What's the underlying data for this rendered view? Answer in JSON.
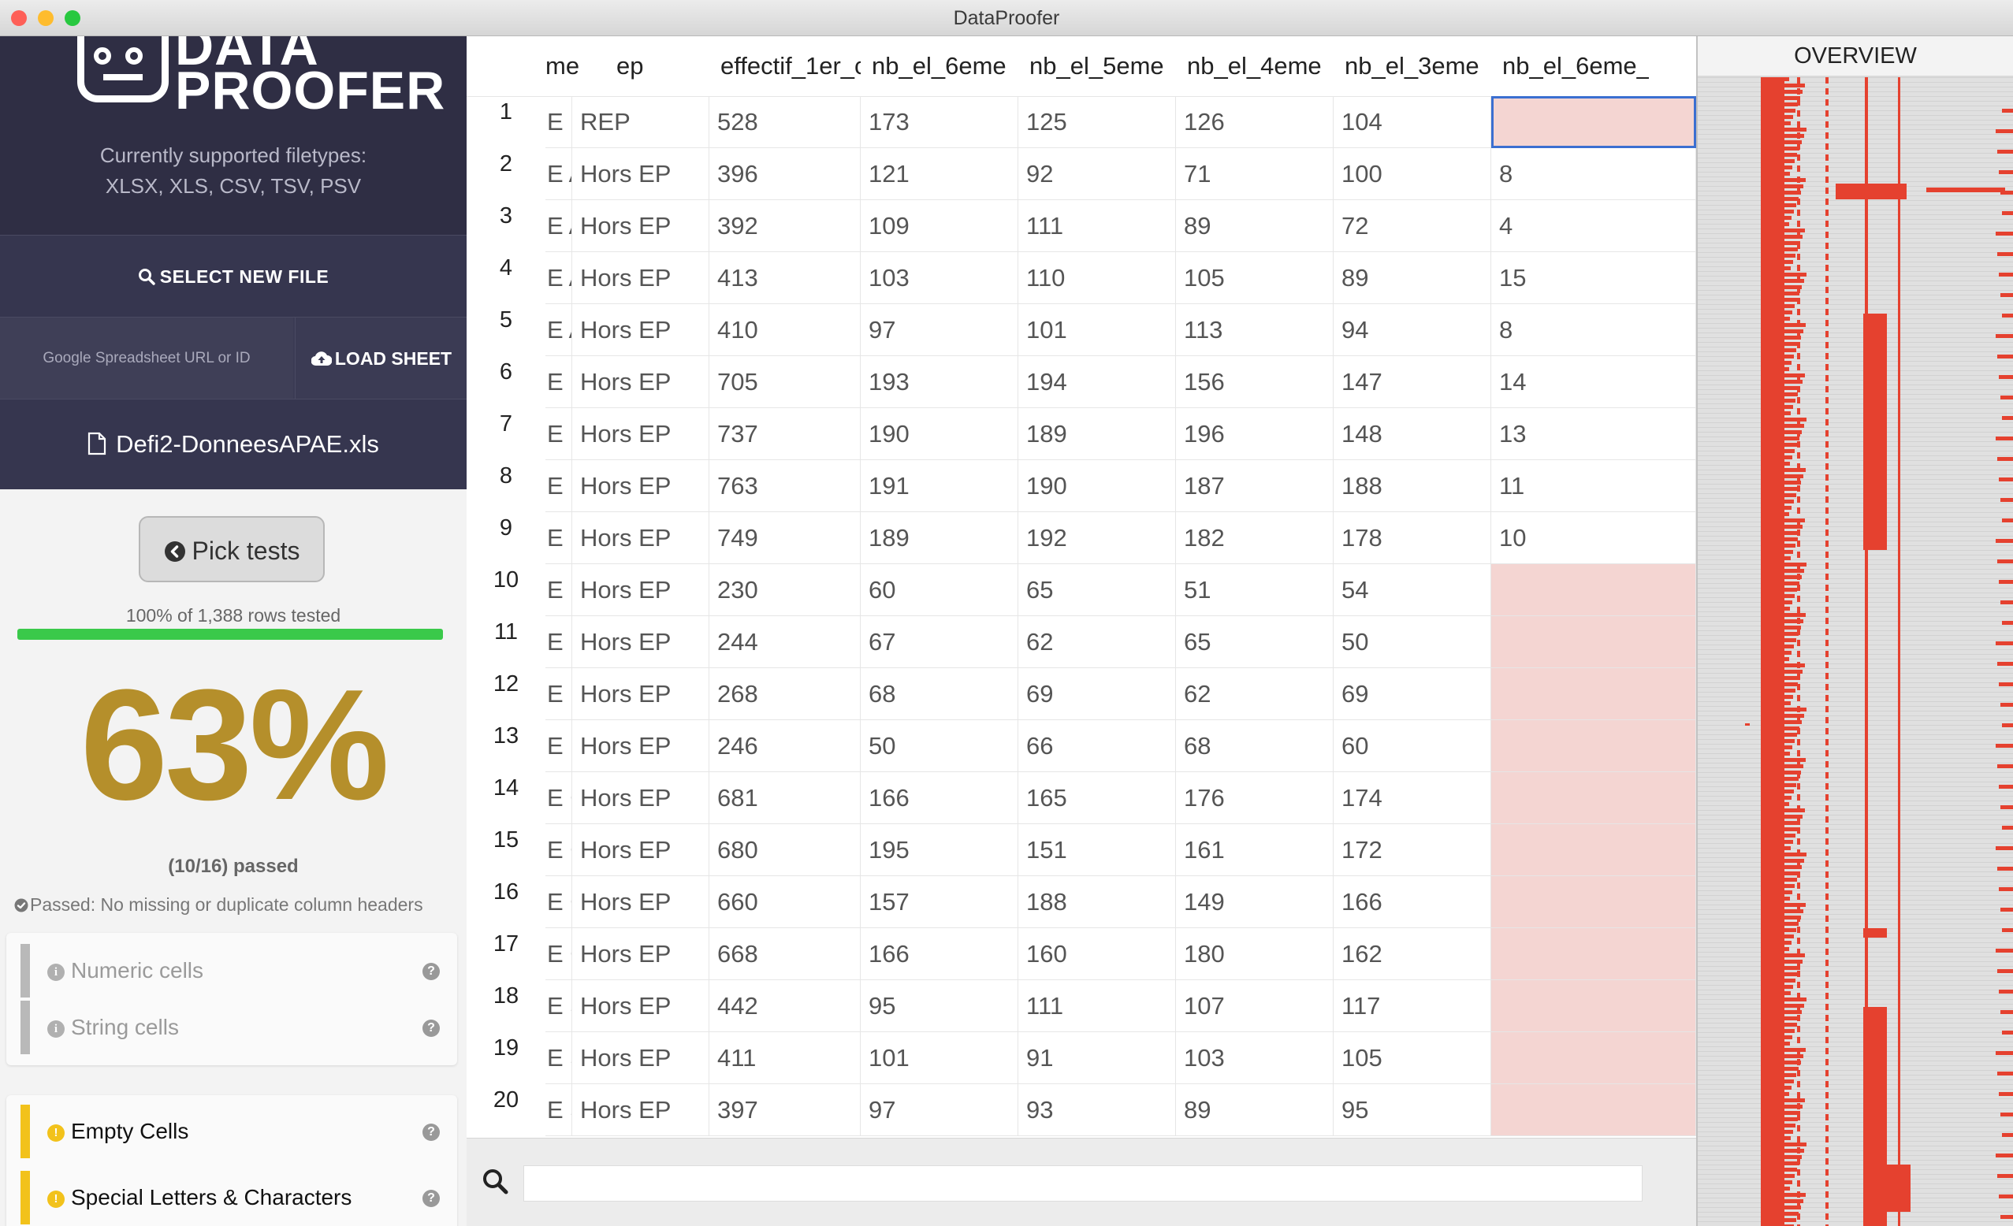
{
  "window": {
    "title": "DataProofer",
    "traffic_lights": {
      "close": "#fe5f57",
      "minimize": "#febc2e",
      "zoom": "#28c840"
    }
  },
  "sidebar": {
    "logo_text_top": "DATA",
    "logo_text_bottom": "PROOFER",
    "supported_line1": "Currently supported filetypes:",
    "supported_line2": "XLSX, XLS, CSV, TSV, PSV",
    "select_file_label": "SELECT NEW FILE",
    "sheet_input_placeholder": "Google Spreadsheet URL or ID",
    "load_sheet_label": "LOAD SHEET",
    "file_name": "Defi2-DonneesAPAE.xls",
    "pick_tests_label": "Pick tests",
    "rows_tested": "100% of 1,388 rows tested",
    "rows_tested_fraction": 1.0,
    "score": "63%",
    "passed_count": "(10/16) passed",
    "passed_note": "Passed: No missing or duplicate column headers",
    "tests_group1": [
      {
        "label": "Numeric cells"
      },
      {
        "label": "String cells"
      }
    ],
    "tests_group2": [
      {
        "label": "Empty Cells"
      },
      {
        "label": "Special Letters & Characters"
      }
    ],
    "colors": {
      "header_bg": "#2f2e44",
      "score": "#b58f2b",
      "progress": "#3ac94a",
      "warning": "#f2c21b",
      "neutral": "#bdbdbd"
    }
  },
  "grid": {
    "columns": [
      "me",
      "ep",
      "effectif_1er_c",
      "nb_el_6eme",
      "nb_el_5eme",
      "nb_el_4eme",
      "nb_el_3eme",
      "nb_el_6eme_"
    ],
    "rows": [
      {
        "n": "1",
        "c": [
          "E DU",
          "REP",
          "528",
          "173",
          "125",
          "126",
          "104",
          ""
        ]
      },
      {
        "n": "2",
        "c": [
          "E AN",
          "Hors EP",
          "396",
          "121",
          "92",
          "71",
          "100",
          "8"
        ]
      },
      {
        "n": "3",
        "c": [
          "E AN",
          "Hors EP",
          "392",
          "109",
          "111",
          "89",
          "72",
          "4"
        ]
      },
      {
        "n": "4",
        "c": [
          "E AN",
          "Hors EP",
          "413",
          "103",
          "110",
          "105",
          "89",
          "15"
        ]
      },
      {
        "n": "5",
        "c": [
          "E AN",
          "Hors EP",
          "410",
          "97",
          "101",
          "113",
          "94",
          "8"
        ]
      },
      {
        "n": "6",
        "c": [
          "E LA",
          "Hors EP",
          "705",
          "193",
          "194",
          "156",
          "147",
          "14"
        ]
      },
      {
        "n": "7",
        "c": [
          "E LA",
          "Hors EP",
          "737",
          "190",
          "189",
          "196",
          "148",
          "13"
        ]
      },
      {
        "n": "8",
        "c": [
          "E LA",
          "Hors EP",
          "763",
          "191",
          "190",
          "187",
          "188",
          "11"
        ]
      },
      {
        "n": "9",
        "c": [
          "E LA",
          "Hors EP",
          "749",
          "189",
          "192",
          "182",
          "178",
          "10"
        ]
      },
      {
        "n": "10",
        "c": [
          "E LU",
          "Hors EP",
          "230",
          "60",
          "65",
          "51",
          "54",
          ""
        ]
      },
      {
        "n": "11",
        "c": [
          "E LU",
          "Hors EP",
          "244",
          "67",
          "62",
          "65",
          "50",
          ""
        ]
      },
      {
        "n": "12",
        "c": [
          "E LU",
          "Hors EP",
          "268",
          "68",
          "69",
          "62",
          "69",
          ""
        ]
      },
      {
        "n": "13",
        "c": [
          "E LU",
          "Hors EP",
          "246",
          "50",
          "66",
          "68",
          "60",
          ""
        ]
      },
      {
        "n": "14",
        "c": [
          "E CI",
          "Hors EP",
          "681",
          "166",
          "165",
          "176",
          "174",
          ""
        ]
      },
      {
        "n": "15",
        "c": [
          "E CI",
          "Hors EP",
          "680",
          "195",
          "151",
          "161",
          "172",
          ""
        ]
      },
      {
        "n": "16",
        "c": [
          "E CI",
          "Hors EP",
          "660",
          "157",
          "188",
          "149",
          "166",
          ""
        ]
      },
      {
        "n": "17",
        "c": [
          "E CI",
          "Hors EP",
          "668",
          "166",
          "160",
          "180",
          "162",
          ""
        ]
      },
      {
        "n": "18",
        "c": [
          "E ST",
          "Hors EP",
          "442",
          "95",
          "111",
          "107",
          "117",
          ""
        ]
      },
      {
        "n": "19",
        "c": [
          "E ST",
          "Hors EP",
          "411",
          "101",
          "91",
          "103",
          "105",
          ""
        ]
      },
      {
        "n": "20",
        "c": [
          "E ST",
          "Hors EP",
          "397",
          "97",
          "93",
          "89",
          "95",
          ""
        ]
      }
    ],
    "error_color": "#f4d5d2",
    "error_marker_color": "#e0302a"
  },
  "overview": {
    "title": "OVERVIEW",
    "error_color": "#e5412f"
  }
}
